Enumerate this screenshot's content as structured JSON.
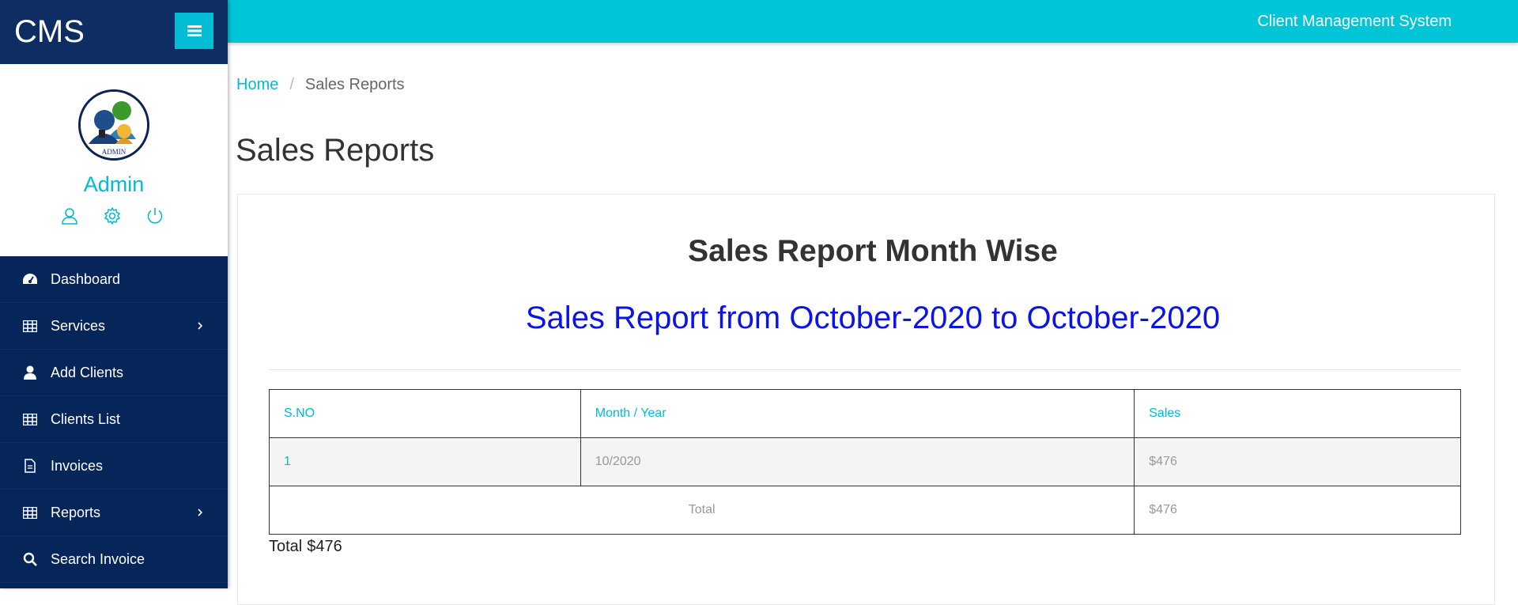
{
  "brand": {
    "name": "CMS"
  },
  "header": {
    "app_title": "Client Management System"
  },
  "profile": {
    "name": "Admin",
    "avatar_text": "ADMIN"
  },
  "sidebar": {
    "items": [
      {
        "label": "Dashboard",
        "icon": "dashboard-icon"
      },
      {
        "label": "Services",
        "icon": "table-icon",
        "has_submenu": true
      },
      {
        "label": "Add Clients",
        "icon": "user-icon"
      },
      {
        "label": "Clients List",
        "icon": "table-icon"
      },
      {
        "label": "Invoices",
        "icon": "file-icon"
      },
      {
        "label": "Reports",
        "icon": "table-icon",
        "has_submenu": true
      },
      {
        "label": "Search Invoice",
        "icon": "search-icon"
      }
    ]
  },
  "breadcrumb": {
    "home": "Home",
    "separator": "/",
    "current": "Sales Reports"
  },
  "page": {
    "title": "Sales Reports"
  },
  "report": {
    "heading": "Sales Report Month Wise",
    "range": "Sales Report from October-2020 to October-2020",
    "table": {
      "headers": [
        "S.NO",
        "Month / Year",
        "Sales"
      ],
      "rows": [
        {
          "sno": "1",
          "month": "10/2020",
          "sales": "$476"
        }
      ],
      "total_label": "Total",
      "total_value": "$476"
    },
    "footer_total_label": "Total",
    "footer_total_value": "$476"
  },
  "colors": {
    "sidebar": "#06265a",
    "accent": "#00bcd4",
    "topbar": "#00c5d7",
    "range_text": "#0a14e6"
  }
}
